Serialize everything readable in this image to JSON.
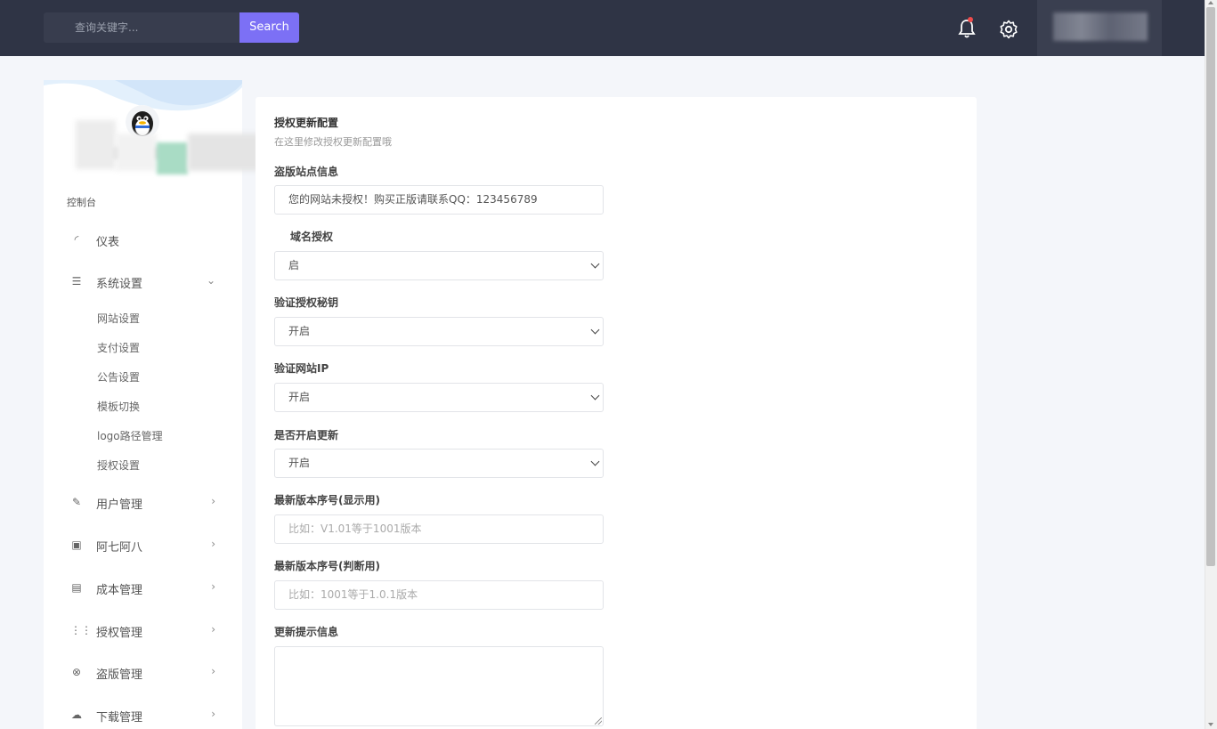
{
  "topbar": {
    "search_placeholder": "查询关键字...",
    "search_button": "Search"
  },
  "sidebar": {
    "section_label": "控制台",
    "menu": [
      {
        "label": "仪表",
        "icon": "dashboard-icon"
      },
      {
        "label": "系统设置",
        "icon": "list-icon",
        "expanded": true
      },
      {
        "label": "用户管理",
        "icon": "edit-icon"
      },
      {
        "label": "阿七阿八",
        "icon": "calendar-icon"
      },
      {
        "label": "成本管理",
        "icon": "money-icon"
      },
      {
        "label": "授权管理",
        "icon": "grid-icon"
      },
      {
        "label": "盗版管理",
        "icon": "close-circle-icon"
      },
      {
        "label": "下载管理",
        "icon": "cloud-download-icon"
      }
    ],
    "submenu": [
      "网站设置",
      "支付设置",
      "公告设置",
      "模板切换",
      "logo路径管理",
      "授权设置"
    ]
  },
  "form": {
    "title": "授权更新配置",
    "subtitle": "在这里修改授权更新配置哦",
    "fields": [
      {
        "label": "盗版站点信息",
        "value": "您的网站未授权！购买正版请联系QQ：123456789"
      },
      {
        "label": "域名授权",
        "value": "启"
      },
      {
        "label": "验证授权秘钥",
        "value": "开启"
      },
      {
        "label": "验证网站IP",
        "value": "开启"
      },
      {
        "label": "是否开启更新",
        "value": "开启"
      },
      {
        "label": "最新版本序号(显示用)",
        "placeholder": "比如：V1.01等于1001版本"
      },
      {
        "label": "最新版本序号(判断用)",
        "placeholder": "比如：1001等于1.0.1版本"
      },
      {
        "label": "更新提示信息",
        "value": ""
      }
    ]
  }
}
